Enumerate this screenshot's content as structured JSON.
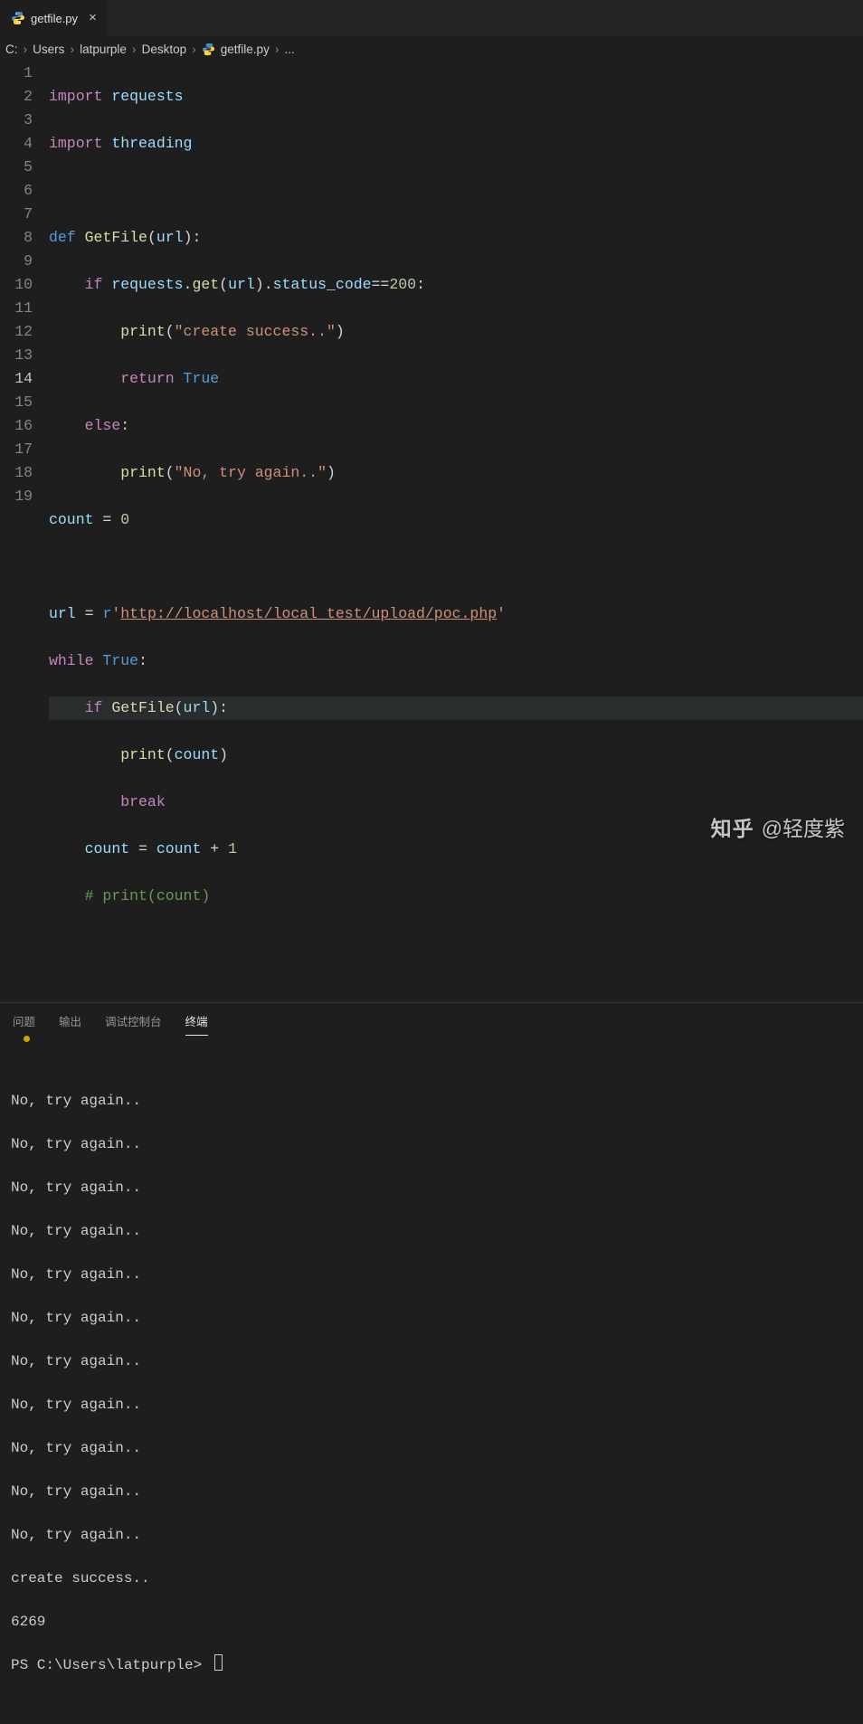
{
  "tab": {
    "filename": "getfile.py"
  },
  "breadcrumbs": {
    "parts": [
      "C:",
      "Users",
      "latpurple",
      "Desktop",
      "getfile.py",
      "..."
    ]
  },
  "lines": {
    "n1": "1",
    "n2": "2",
    "n3": "3",
    "n4": "4",
    "n5": "5",
    "n6": "6",
    "n7": "7",
    "n8": "8",
    "n9": "9",
    "n10": "10",
    "n11": "11",
    "n12": "12",
    "n13": "13",
    "n14": "14",
    "n15": "15",
    "n16": "16",
    "n17": "17",
    "n18": "18",
    "n19": "19"
  },
  "code": {
    "kw_import": "import",
    "mod_requests": "requests",
    "mod_threading": "threading",
    "kw_def": "def",
    "fn_getfile": "GetFile",
    "p_url": "url",
    "colon": ":",
    "kw_if": "if",
    "dot": ".",
    "m_get": "get",
    "m_status": "status_code",
    "eq2": "==",
    "n200": "200",
    "fn_print": "print",
    "s_create": "\"create success..\"",
    "kw_return": "return",
    "bool_true": "True",
    "kw_else": "else",
    "s_no": "\"No, try again..\"",
    "v_count": "count",
    "eq": " = ",
    "n0": "0",
    "v_url": "url",
    "rprefix": "r",
    "squote": "'",
    "url": "http://localhost/local_test/upload/poc.php",
    "kw_while": "while",
    "kw_break": "break",
    "plus": " + ",
    "n1": "1",
    "cmt": "# print(count)"
  },
  "panel": {
    "tabs": {
      "problems": "问题",
      "output": "输出",
      "debug": "调试控制台",
      "terminal": "终端"
    }
  },
  "terminal": {
    "line_no": "No, try again..",
    "line_success": "create success..",
    "count": "6269",
    "prompt": "PS C:\\Users\\latpurple> "
  },
  "watermark": {
    "logo": "知乎",
    "author": "@轻度紫"
  }
}
